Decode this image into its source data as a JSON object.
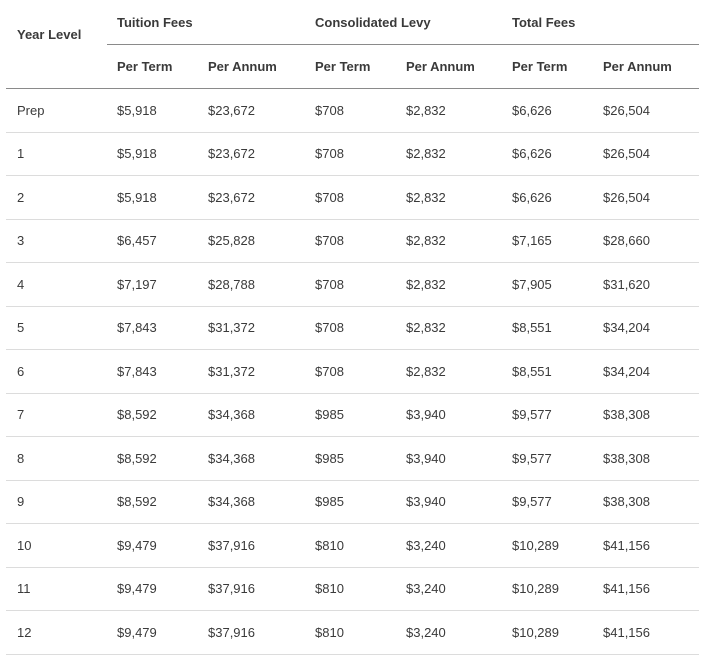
{
  "table": {
    "header": {
      "year_level": "Year Level",
      "groups": [
        "Tuition Fees",
        "Consolidated Levy",
        "Total Fees"
      ],
      "sub": [
        "Per Term",
        "Per Annum",
        "Per Term",
        "Per Annum",
        "Per Term",
        "Per Annum"
      ]
    },
    "rows": [
      [
        "Prep",
        "$5,918",
        "$23,672",
        "$708",
        "$2,832",
        "$6,626",
        "$26,504"
      ],
      [
        "1",
        "$5,918",
        "$23,672",
        "$708",
        "$2,832",
        "$6,626",
        "$26,504"
      ],
      [
        "2",
        "$5,918",
        "$23,672",
        "$708",
        "$2,832",
        "$6,626",
        "$26,504"
      ],
      [
        "3",
        "$6,457",
        "$25,828",
        "$708",
        "$2,832",
        "$7,165",
        "$28,660"
      ],
      [
        "4",
        "$7,197",
        "$28,788",
        "$708",
        "$2,832",
        "$7,905",
        "$31,620"
      ],
      [
        "5",
        "$7,843",
        "$31,372",
        "$708",
        "$2,832",
        "$8,551",
        "$34,204"
      ],
      [
        "6",
        "$7,843",
        "$31,372",
        "$708",
        "$2,832",
        "$8,551",
        "$34,204"
      ],
      [
        "7",
        "$8,592",
        "$34,368",
        "$985",
        "$3,940",
        "$9,577",
        "$38,308"
      ],
      [
        "8",
        "$8,592",
        "$34,368",
        "$985",
        "$3,940",
        "$9,577",
        "$38,308"
      ],
      [
        "9",
        "$8,592",
        "$34,368",
        "$985",
        "$3,940",
        "$9,577",
        "$38,308"
      ],
      [
        "10",
        "$9,479",
        "$37,916",
        "$810",
        "$3,240",
        "$10,289",
        "$41,156"
      ],
      [
        "11",
        "$9,479",
        "$37,916",
        "$810",
        "$3,240",
        "$10,289",
        "$41,156"
      ],
      [
        "12",
        "$9,479",
        "$37,916",
        "$810",
        "$3,240",
        "$10,289",
        "$41,156"
      ]
    ]
  }
}
